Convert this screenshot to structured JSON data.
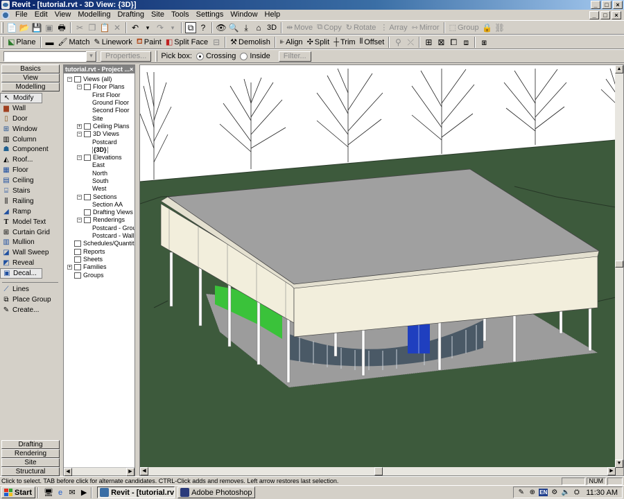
{
  "window": {
    "title": "Revit - [tutorial.rvt - 3D View: {3D}]",
    "controls": [
      "_",
      "□",
      "×"
    ]
  },
  "menu": [
    "File",
    "Edit",
    "View",
    "Modelling",
    "Drafting",
    "Site",
    "Tools",
    "Settings",
    "Window",
    "Help"
  ],
  "toolbar1": {
    "view_label": "3D",
    "edit_tools": [
      "Move",
      "Copy",
      "Rotate",
      "Array",
      "Mirror",
      "Group"
    ]
  },
  "toolbar2": {
    "tools": [
      "Plane",
      "Match",
      "Linework",
      "Paint",
      "Split Face",
      "Demolish",
      "Align",
      "Split",
      "Trim",
      "Offset"
    ]
  },
  "toolbar3": {
    "properties_label": "Properties...",
    "pick_box_label": "Pick box:",
    "crossing_label": "Crossing",
    "inside_label": "Inside",
    "filter_label": "Filter..."
  },
  "designbar": {
    "top_tabs": [
      "Basics",
      "View",
      "Modelling"
    ],
    "tools": [
      "Modify",
      "Wall",
      "Door",
      "Window",
      "Column",
      "Component",
      "Roof...",
      "Floor",
      "Ceiling",
      "Stairs",
      "Railing",
      "Ramp",
      "Model Text",
      "Curtain Grid",
      "Mullion",
      "Wall Sweep",
      "Reveal",
      "Decal..."
    ],
    "tools2": [
      "Lines",
      "Place Group",
      "Create..."
    ],
    "bottom_tabs": [
      "Drafting",
      "Rendering",
      "Site",
      "Structural"
    ]
  },
  "browser": {
    "title": "tutorial.rvt - Project ...",
    "close": "×",
    "tree": [
      {
        "label": "Views (all)",
        "level": 0,
        "exp": "−"
      },
      {
        "label": "Floor Plans",
        "level": 1,
        "exp": "−"
      },
      {
        "label": "First Floor",
        "level": 2
      },
      {
        "label": "Ground Floor",
        "level": 2
      },
      {
        "label": "Second Floor",
        "level": 2
      },
      {
        "label": "Site",
        "level": 2
      },
      {
        "label": "Ceiling Plans",
        "level": 1,
        "exp": "+"
      },
      {
        "label": "3D Views",
        "level": 1,
        "exp": "−"
      },
      {
        "label": "Postcard",
        "level": 2
      },
      {
        "label": "{3D}",
        "level": 2,
        "bold": true
      },
      {
        "label": "Elevations",
        "level": 1,
        "exp": "−"
      },
      {
        "label": "East",
        "level": 2
      },
      {
        "label": "North",
        "level": 2
      },
      {
        "label": "South",
        "level": 2
      },
      {
        "label": "West",
        "level": 2
      },
      {
        "label": "Sections",
        "level": 1,
        "exp": "−"
      },
      {
        "label": "Section AA",
        "level": 2
      },
      {
        "label": "Drafting Views",
        "level": 1
      },
      {
        "label": "Renderings",
        "level": 1,
        "exp": "−"
      },
      {
        "label": "Postcard - Grou",
        "level": 2
      },
      {
        "label": "Postcard - Wall-",
        "level": 2
      },
      {
        "label": "Schedules/Quantitie",
        "level": 0
      },
      {
        "label": "Reports",
        "level": 0
      },
      {
        "label": "Sheets",
        "level": 0
      },
      {
        "label": "Families",
        "level": 0,
        "exp": "+"
      },
      {
        "label": "Groups",
        "level": 0
      }
    ]
  },
  "status": {
    "message": "Click to select. TAB before click for alternate candidates. CTRL-Click adds and removes. Left arrow restores last selection.",
    "num": "NUM"
  },
  "taskbar": {
    "start": "Start",
    "tasks": [
      {
        "label": "Revit - [tutorial.rvt ...",
        "active": true
      },
      {
        "label": "Adobe Photoshop",
        "active": false
      }
    ],
    "lang": "EN",
    "clock": "11:30 AM"
  },
  "colors": {
    "ground": "#3d5a3c",
    "sky": "#ffffff",
    "roof": "#a0a0a0",
    "fascia": "#f2eedc",
    "paving": "#9c9c9c",
    "glass": "#4a5966",
    "door": "#1f3fbf",
    "panel_green": "#3ac23a"
  }
}
